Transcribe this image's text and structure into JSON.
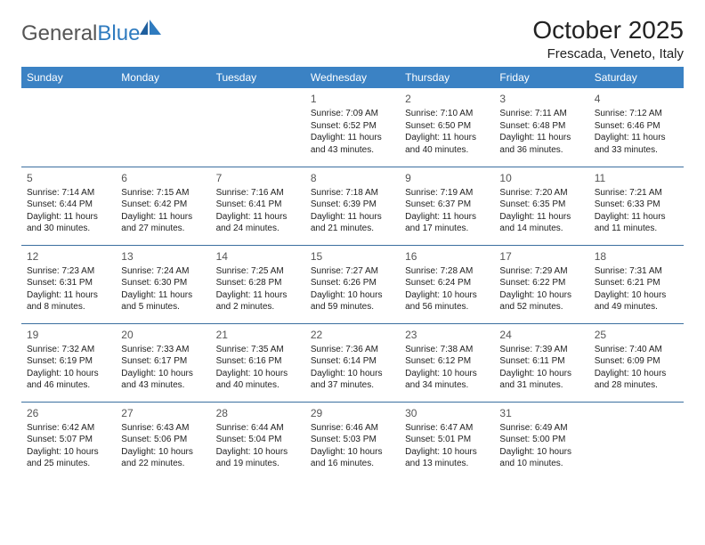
{
  "header": {
    "logo_general": "General",
    "logo_blue": "Blue",
    "title": "October 2025",
    "subtitle": "Frescada, Veneto, Italy"
  },
  "weekdays": [
    "Sunday",
    "Monday",
    "Tuesday",
    "Wednesday",
    "Thursday",
    "Friday",
    "Saturday"
  ],
  "weeks": [
    [
      null,
      null,
      null,
      {
        "n": "1",
        "sr": "Sunrise: 7:09 AM",
        "ss": "Sunset: 6:52 PM",
        "d1": "Daylight: 11 hours",
        "d2": "and 43 minutes."
      },
      {
        "n": "2",
        "sr": "Sunrise: 7:10 AM",
        "ss": "Sunset: 6:50 PM",
        "d1": "Daylight: 11 hours",
        "d2": "and 40 minutes."
      },
      {
        "n": "3",
        "sr": "Sunrise: 7:11 AM",
        "ss": "Sunset: 6:48 PM",
        "d1": "Daylight: 11 hours",
        "d2": "and 36 minutes."
      },
      {
        "n": "4",
        "sr": "Sunrise: 7:12 AM",
        "ss": "Sunset: 6:46 PM",
        "d1": "Daylight: 11 hours",
        "d2": "and 33 minutes."
      }
    ],
    [
      {
        "n": "5",
        "sr": "Sunrise: 7:14 AM",
        "ss": "Sunset: 6:44 PM",
        "d1": "Daylight: 11 hours",
        "d2": "and 30 minutes."
      },
      {
        "n": "6",
        "sr": "Sunrise: 7:15 AM",
        "ss": "Sunset: 6:42 PM",
        "d1": "Daylight: 11 hours",
        "d2": "and 27 minutes."
      },
      {
        "n": "7",
        "sr": "Sunrise: 7:16 AM",
        "ss": "Sunset: 6:41 PM",
        "d1": "Daylight: 11 hours",
        "d2": "and 24 minutes."
      },
      {
        "n": "8",
        "sr": "Sunrise: 7:18 AM",
        "ss": "Sunset: 6:39 PM",
        "d1": "Daylight: 11 hours",
        "d2": "and 21 minutes."
      },
      {
        "n": "9",
        "sr": "Sunrise: 7:19 AM",
        "ss": "Sunset: 6:37 PM",
        "d1": "Daylight: 11 hours",
        "d2": "and 17 minutes."
      },
      {
        "n": "10",
        "sr": "Sunrise: 7:20 AM",
        "ss": "Sunset: 6:35 PM",
        "d1": "Daylight: 11 hours",
        "d2": "and 14 minutes."
      },
      {
        "n": "11",
        "sr": "Sunrise: 7:21 AM",
        "ss": "Sunset: 6:33 PM",
        "d1": "Daylight: 11 hours",
        "d2": "and 11 minutes."
      }
    ],
    [
      {
        "n": "12",
        "sr": "Sunrise: 7:23 AM",
        "ss": "Sunset: 6:31 PM",
        "d1": "Daylight: 11 hours",
        "d2": "and 8 minutes."
      },
      {
        "n": "13",
        "sr": "Sunrise: 7:24 AM",
        "ss": "Sunset: 6:30 PM",
        "d1": "Daylight: 11 hours",
        "d2": "and 5 minutes."
      },
      {
        "n": "14",
        "sr": "Sunrise: 7:25 AM",
        "ss": "Sunset: 6:28 PM",
        "d1": "Daylight: 11 hours",
        "d2": "and 2 minutes."
      },
      {
        "n": "15",
        "sr": "Sunrise: 7:27 AM",
        "ss": "Sunset: 6:26 PM",
        "d1": "Daylight: 10 hours",
        "d2": "and 59 minutes."
      },
      {
        "n": "16",
        "sr": "Sunrise: 7:28 AM",
        "ss": "Sunset: 6:24 PM",
        "d1": "Daylight: 10 hours",
        "d2": "and 56 minutes."
      },
      {
        "n": "17",
        "sr": "Sunrise: 7:29 AM",
        "ss": "Sunset: 6:22 PM",
        "d1": "Daylight: 10 hours",
        "d2": "and 52 minutes."
      },
      {
        "n": "18",
        "sr": "Sunrise: 7:31 AM",
        "ss": "Sunset: 6:21 PM",
        "d1": "Daylight: 10 hours",
        "d2": "and 49 minutes."
      }
    ],
    [
      {
        "n": "19",
        "sr": "Sunrise: 7:32 AM",
        "ss": "Sunset: 6:19 PM",
        "d1": "Daylight: 10 hours",
        "d2": "and 46 minutes."
      },
      {
        "n": "20",
        "sr": "Sunrise: 7:33 AM",
        "ss": "Sunset: 6:17 PM",
        "d1": "Daylight: 10 hours",
        "d2": "and 43 minutes."
      },
      {
        "n": "21",
        "sr": "Sunrise: 7:35 AM",
        "ss": "Sunset: 6:16 PM",
        "d1": "Daylight: 10 hours",
        "d2": "and 40 minutes."
      },
      {
        "n": "22",
        "sr": "Sunrise: 7:36 AM",
        "ss": "Sunset: 6:14 PM",
        "d1": "Daylight: 10 hours",
        "d2": "and 37 minutes."
      },
      {
        "n": "23",
        "sr": "Sunrise: 7:38 AM",
        "ss": "Sunset: 6:12 PM",
        "d1": "Daylight: 10 hours",
        "d2": "and 34 minutes."
      },
      {
        "n": "24",
        "sr": "Sunrise: 7:39 AM",
        "ss": "Sunset: 6:11 PM",
        "d1": "Daylight: 10 hours",
        "d2": "and 31 minutes."
      },
      {
        "n": "25",
        "sr": "Sunrise: 7:40 AM",
        "ss": "Sunset: 6:09 PM",
        "d1": "Daylight: 10 hours",
        "d2": "and 28 minutes."
      }
    ],
    [
      {
        "n": "26",
        "sr": "Sunrise: 6:42 AM",
        "ss": "Sunset: 5:07 PM",
        "d1": "Daylight: 10 hours",
        "d2": "and 25 minutes."
      },
      {
        "n": "27",
        "sr": "Sunrise: 6:43 AM",
        "ss": "Sunset: 5:06 PM",
        "d1": "Daylight: 10 hours",
        "d2": "and 22 minutes."
      },
      {
        "n": "28",
        "sr": "Sunrise: 6:44 AM",
        "ss": "Sunset: 5:04 PM",
        "d1": "Daylight: 10 hours",
        "d2": "and 19 minutes."
      },
      {
        "n": "29",
        "sr": "Sunrise: 6:46 AM",
        "ss": "Sunset: 5:03 PM",
        "d1": "Daylight: 10 hours",
        "d2": "and 16 minutes."
      },
      {
        "n": "30",
        "sr": "Sunrise: 6:47 AM",
        "ss": "Sunset: 5:01 PM",
        "d1": "Daylight: 10 hours",
        "d2": "and 13 minutes."
      },
      {
        "n": "31",
        "sr": "Sunrise: 6:49 AM",
        "ss": "Sunset: 5:00 PM",
        "d1": "Daylight: 10 hours",
        "d2": "and 10 minutes."
      },
      null
    ]
  ]
}
